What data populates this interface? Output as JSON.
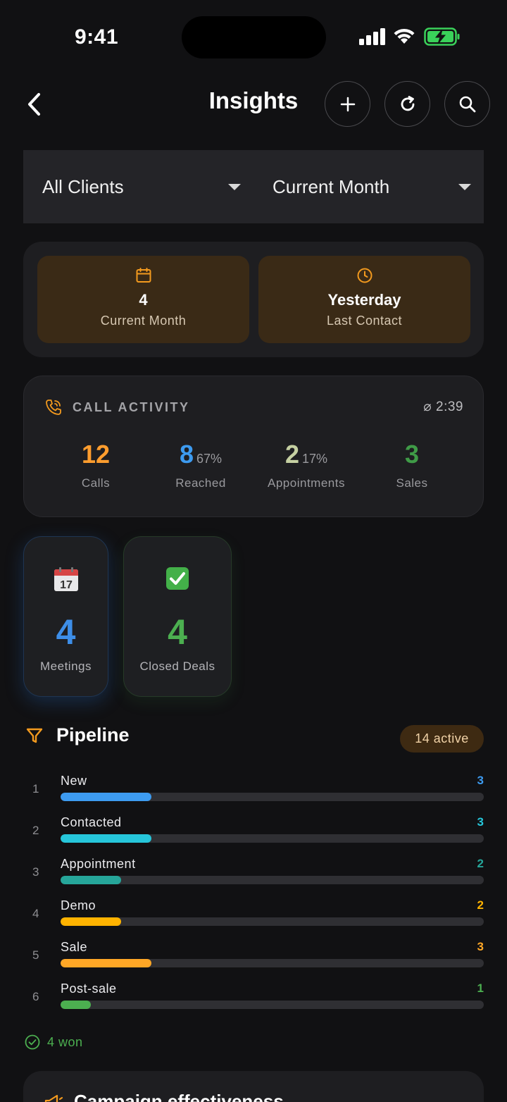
{
  "status_bar": {
    "time": "9:41"
  },
  "header": {
    "title": "Insights"
  },
  "filters": {
    "client": "All Clients",
    "period": "Current Month"
  },
  "summary": {
    "tiles": [
      {
        "icon": "calendar-icon",
        "value": "4",
        "label": "Current Month"
      },
      {
        "icon": "clock-icon",
        "value": "Yesterday",
        "label": "Last Contact"
      }
    ]
  },
  "call_activity": {
    "title": "CALL ACTIVITY",
    "avg_duration": "⌀ 2:39",
    "stats": [
      {
        "value": "12",
        "pct": "",
        "label": "Calls",
        "color": "#ff9d2e"
      },
      {
        "value": "8",
        "pct": "67%",
        "label": "Reached",
        "color": "#3d9bf0"
      },
      {
        "value": "2",
        "pct": "17%",
        "label": "Appointments",
        "color": "#c5d0a2"
      },
      {
        "value": "3",
        "pct": "",
        "label": "Sales",
        "color": "#3f9b47"
      }
    ]
  },
  "mini_cards": [
    {
      "icon": "calendar-emoji-icon",
      "value": "4",
      "label": "Meetings",
      "color": "#3d8ee8"
    },
    {
      "icon": "check-emoji-icon",
      "value": "4",
      "label": "Closed Deals",
      "color": "#4caf50"
    }
  ],
  "pipeline": {
    "title": "Pipeline",
    "active_badge": "14 active",
    "max_count": 14,
    "stages": [
      {
        "index": "1",
        "name": "New",
        "count": 3,
        "color": "#3d9bf0"
      },
      {
        "index": "2",
        "name": "Contacted",
        "count": 3,
        "color": "#26c6da"
      },
      {
        "index": "3",
        "name": "Appointment",
        "count": 2,
        "color": "#26a69a"
      },
      {
        "index": "4",
        "name": "Demo",
        "count": 2,
        "color": "#ffb300"
      },
      {
        "index": "5",
        "name": "Sale",
        "count": 3,
        "color": "#ffa726"
      },
      {
        "index": "6",
        "name": "Post-sale",
        "count": 1,
        "color": "#4caf50"
      }
    ],
    "won_label": "4 won"
  },
  "campaign": {
    "title": "Campaign effectiveness"
  }
}
